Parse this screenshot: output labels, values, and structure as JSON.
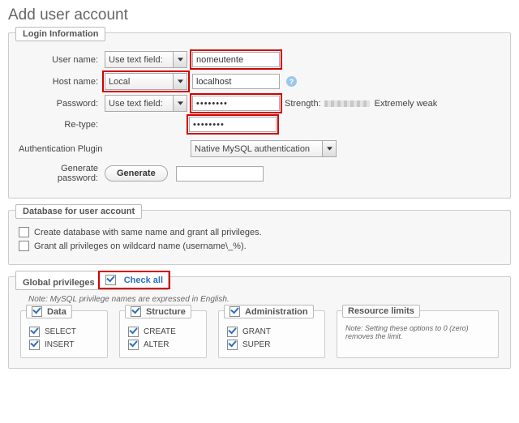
{
  "title": "Add user account",
  "login": {
    "legend": "Login Information",
    "username_label": "User name:",
    "username_mode": "Use text field:",
    "username_value": "nomeutente",
    "hostname_label": "Host name:",
    "hostname_mode": "Local",
    "hostname_value": "localhost",
    "password_label": "Password:",
    "password_mode": "Use text field:",
    "password_value": "••••••••",
    "strength_label": "Strength:",
    "strength_text": "Extremely weak",
    "retype_label": "Re-type:",
    "retype_value": "••••••••",
    "auth_label": "Authentication Plugin",
    "auth_value": "Native MySQL authentication",
    "generate_label": "Generate password:",
    "generate_btn": "Generate"
  },
  "db": {
    "legend": "Database for user account",
    "opt1": "Create database with same name and grant all privileges.",
    "opt2": "Grant all privileges on wildcard name (username\\_%)."
  },
  "global": {
    "legend": "Global privileges",
    "check_all": "Check all",
    "note": "Note: MySQL privilege names are expressed in English.",
    "data_legend": "Data",
    "structure_legend": "Structure",
    "admin_legend": "Administration",
    "resource_legend": "Resource limits",
    "resource_note": "Note: Setting these options to 0 (zero) removes the limit.",
    "p_select": "SELECT",
    "p_insert": "INSERT",
    "p_create": "CREATE",
    "p_alter": "ALTER",
    "p_grant": "GRANT",
    "p_super": "SUPER"
  }
}
